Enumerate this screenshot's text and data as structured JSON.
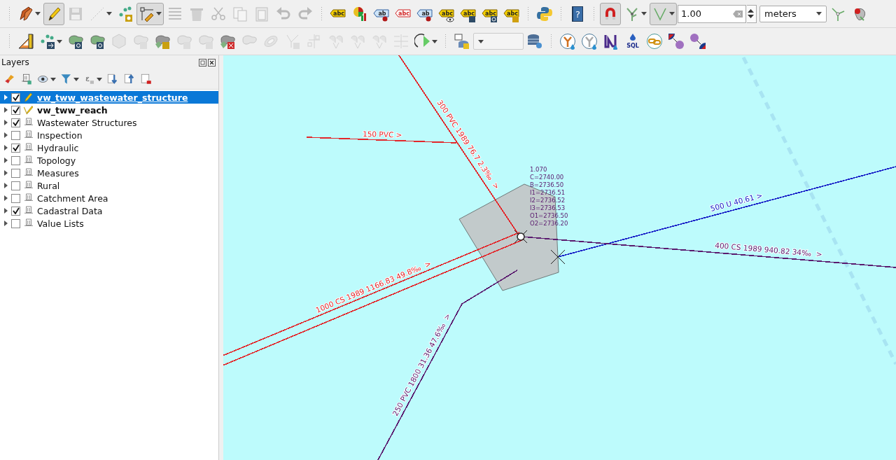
{
  "toolbar_1": [
    [
      {
        "kind": "pencils",
        "disabled": false,
        "pressed": false,
        "menu": true
      },
      {
        "kind": "pencil",
        "disabled": false,
        "pressed": true,
        "menu": false
      },
      {
        "kind": "save",
        "disabled": true,
        "pressed": false,
        "menu": false
      },
      {
        "kind": "line",
        "disabled": true,
        "pressed": false,
        "menu": true
      },
      {
        "kind": "points-gear",
        "disabled": false,
        "pressed": false,
        "menu": false
      },
      {
        "kind": "vertex",
        "disabled": false,
        "pressed": true,
        "menu": true
      },
      {
        "kind": "table",
        "disabled": true,
        "pressed": false,
        "menu": false
      },
      {
        "kind": "trash",
        "disabled": true,
        "pressed": false,
        "menu": false
      },
      {
        "kind": "scissors",
        "disabled": true,
        "pressed": false,
        "menu": false
      },
      {
        "kind": "copy",
        "disabled": true,
        "pressed": false,
        "menu": false
      },
      {
        "kind": "paste",
        "disabled": true,
        "pressed": false,
        "menu": false
      },
      {
        "kind": "undo",
        "disabled": true,
        "pressed": false,
        "menu": false
      },
      {
        "kind": "redo",
        "disabled": true,
        "pressed": false,
        "menu": false
      }
    ],
    [
      {
        "kind": "label",
        "text": "abc",
        "disabled": false,
        "pressed": false,
        "menu": false
      },
      {
        "kind": "chart",
        "disabled": false,
        "pressed": false,
        "menu": false
      },
      {
        "kind": "label-pin",
        "text": "ab",
        "disabled": false,
        "pressed": false,
        "menu": false
      },
      {
        "kind": "label-red",
        "text": "abc",
        "disabled": false,
        "pressed": false,
        "menu": false
      },
      {
        "kind": "label-pin",
        "text": "ab",
        "disabled": false,
        "pressed": false,
        "menu": false
      },
      {
        "kind": "label-eye",
        "text": "abc",
        "disabled": false,
        "pressed": false,
        "menu": false
      },
      {
        "kind": "label-move",
        "text": "abc",
        "disabled": false,
        "pressed": false,
        "menu": false
      },
      {
        "kind": "label-rotate",
        "text": "abc",
        "disabled": false,
        "pressed": false,
        "menu": false
      },
      {
        "kind": "label-edit",
        "text": "abc",
        "disabled": false,
        "pressed": false,
        "menu": false
      }
    ],
    [
      {
        "kind": "python",
        "disabled": false,
        "pressed": false,
        "menu": false
      }
    ],
    [
      {
        "kind": "help",
        "text": "?",
        "disabled": false,
        "pressed": false,
        "menu": false
      }
    ],
    [
      {
        "kind": "magnet",
        "disabled": false,
        "pressed": true,
        "menu": false
      },
      {
        "kind": "snap-tree",
        "disabled": false,
        "pressed": false,
        "menu": true
      },
      {
        "kind": "angle",
        "disabled": false,
        "pressed": true,
        "menu": true
      },
      {
        "kind": "field",
        "value": "1.00"
      },
      {
        "kind": "combo",
        "value": "meters"
      },
      {
        "kind": "y-node",
        "disabled": false,
        "pressed": false,
        "menu": false
      },
      {
        "kind": "pin-tool",
        "disabled": false,
        "pressed": false,
        "menu": false
      }
    ]
  ],
  "toolbar_2": [
    [
      {
        "kind": "ruler",
        "disabled": false,
        "pressed": false,
        "menu": false
      },
      {
        "kind": "points-arrow",
        "disabled": false,
        "pressed": false,
        "menu": true
      },
      {
        "kind": "shape-rotate",
        "disabled": false,
        "pressed": false,
        "menu": false
      },
      {
        "kind": "shape-move",
        "disabled": false,
        "pressed": false,
        "menu": false
      },
      {
        "kind": "hexagon",
        "disabled": true,
        "pressed": false,
        "menu": false
      },
      {
        "kind": "shape-gear",
        "disabled": true,
        "pressed": false,
        "menu": false
      },
      {
        "kind": "shapes-gear",
        "disabled": false,
        "pressed": false,
        "menu": false
      },
      {
        "kind": "shape-gear",
        "disabled": true,
        "pressed": false,
        "menu": false
      },
      {
        "kind": "shape-delete",
        "disabled": true,
        "pressed": false,
        "menu": false
      },
      {
        "kind": "shapes-delete",
        "disabled": false,
        "pressed": false,
        "menu": false
      },
      {
        "kind": "shape",
        "disabled": true,
        "pressed": false,
        "menu": false
      },
      {
        "kind": "ring",
        "disabled": true,
        "pressed": false,
        "menu": false
      },
      {
        "kind": "vertex-rotate",
        "disabled": true,
        "pressed": false,
        "menu": false
      },
      {
        "kind": "offset",
        "disabled": true,
        "pressed": false,
        "menu": false
      },
      {
        "kind": "split",
        "disabled": true,
        "pressed": false,
        "menu": false
      },
      {
        "kind": "split",
        "disabled": true,
        "pressed": false,
        "menu": false
      },
      {
        "kind": "split",
        "disabled": true,
        "pressed": false,
        "menu": false
      },
      {
        "kind": "lines",
        "disabled": true,
        "pressed": false,
        "menu": false
      },
      {
        "kind": "rotate-point",
        "disabled": false,
        "pressed": false,
        "menu": true
      }
    ],
    [
      {
        "kind": "db-layer",
        "disabled": false,
        "pressed": false,
        "menu": false
      },
      {
        "kind": "combo",
        "disabled": true
      },
      {
        "kind": "db-gear",
        "disabled": false,
        "pressed": false,
        "menu": false
      }
    ],
    [
      {
        "kind": "y-drop",
        "disabled": false,
        "pressed": false,
        "menu": false
      },
      {
        "kind": "y-drop-light",
        "disabled": false,
        "pressed": false,
        "menu": false
      },
      {
        "kind": "profile",
        "disabled": false,
        "pressed": false,
        "menu": false
      },
      {
        "kind": "sql",
        "text": "SQL",
        "disabled": false,
        "pressed": false,
        "menu": false
      },
      {
        "kind": "link",
        "disabled": false,
        "pressed": false,
        "menu": false
      },
      {
        "kind": "connect",
        "disabled": false,
        "pressed": false,
        "menu": false
      },
      {
        "kind": "connect-rev",
        "disabled": false,
        "pressed": false,
        "menu": false
      }
    ]
  ],
  "layers_panel": {
    "title": "Layers",
    "tools": [
      {
        "kind": "brush"
      },
      {
        "kind": "add-group"
      },
      {
        "kind": "eye",
        "menu": true
      },
      {
        "kind": "filter",
        "menu": true
      },
      {
        "kind": "expression",
        "text": "ε",
        "menu": true
      },
      {
        "kind": "expand-all"
      },
      {
        "kind": "collapse-all"
      },
      {
        "kind": "remove"
      }
    ],
    "items": [
      {
        "label": "vw_tww_wastewater_structure",
        "kind": "edit-layer",
        "checked": true,
        "selected": true,
        "expanded": false
      },
      {
        "label": "vw_tww_reach",
        "kind": "edit-layer-line",
        "checked": true,
        "selected": false,
        "expanded": false
      },
      {
        "label": "Wastewater Structures",
        "kind": "group",
        "checked": true,
        "selected": false,
        "expanded": false
      },
      {
        "label": "Inspection",
        "kind": "group",
        "checked": false,
        "selected": false,
        "expanded": false
      },
      {
        "label": "Hydraulic",
        "kind": "group",
        "checked": true,
        "selected": false,
        "expanded": false
      },
      {
        "label": "Topology",
        "kind": "group",
        "checked": false,
        "selected": false,
        "expanded": false
      },
      {
        "label": "Measures",
        "kind": "group",
        "checked": false,
        "selected": false,
        "expanded": false
      },
      {
        "label": "Rural",
        "kind": "group",
        "checked": false,
        "selected": false,
        "expanded": false
      },
      {
        "label": "Catchment Area",
        "kind": "group",
        "checked": false,
        "selected": false,
        "expanded": false
      },
      {
        "label": "Cadastral Data",
        "kind": "group",
        "checked": true,
        "selected": false,
        "expanded": false
      },
      {
        "label": "Value Lists",
        "kind": "group",
        "checked": false,
        "selected": false,
        "expanded": false
      }
    ]
  },
  "map": {
    "pipes": [
      {
        "label": "300 PVC 1989 76.7 2.3‰  >",
        "color": "#e3262a"
      },
      {
        "label": "150 PVC >",
        "color": "#e3262a"
      },
      {
        "label": "1000 CS 1989 1166.83 49.8‰  >",
        "color": "#e3262a"
      },
      {
        "label": "250 PVC 1800 31.36 47.6‰  >",
        "color": "#5a1a6e"
      },
      {
        "label": "500 U 40.61 >",
        "color": "#1a22c8"
      },
      {
        "label": "400 CS 1989 940.82 34‰  >",
        "color": "#5a1a6e"
      }
    ],
    "structure_annotation": [
      "1.070",
      "C=2740.00",
      "B=2736.50",
      "I1=2736.51",
      "I2=2736.52",
      "I3=2736.53",
      "O1=2736.50",
      "O2=2736.20"
    ]
  }
}
